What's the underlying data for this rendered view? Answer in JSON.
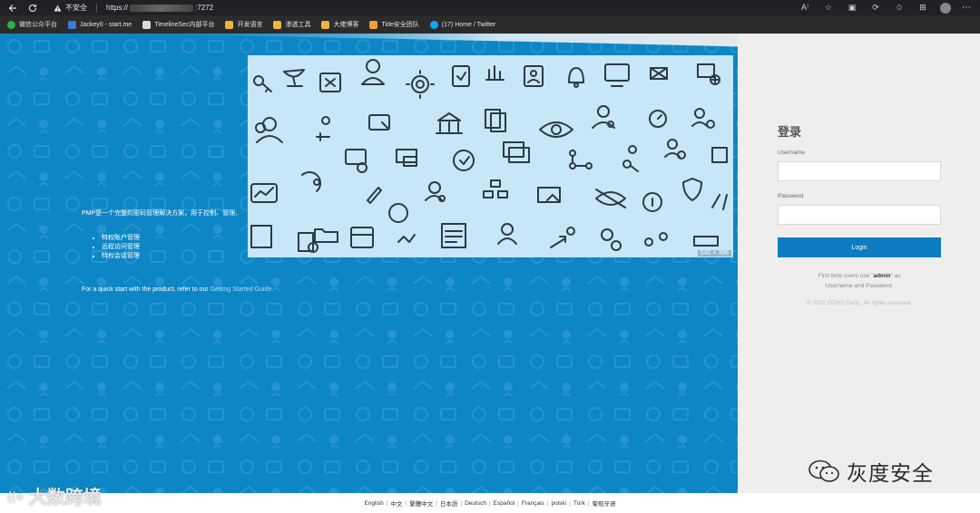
{
  "browser": {
    "not_secure_label": "不安全",
    "url_prefix": "https://",
    "url_suffix": ":7272",
    "bookmarks": [
      {
        "label": "微信公众平台",
        "color": "#2bb24c"
      },
      {
        "label": "Jackey0 - start.me",
        "color": "#3a7bd5"
      },
      {
        "label": "TimelineSec内部平台",
        "color": "#dddddd"
      },
      {
        "label": "开发语言",
        "color": "#e8b63c"
      },
      {
        "label": "渗透工具",
        "color": "#e8b63c"
      },
      {
        "label": "大佬博客",
        "color": "#e8b63c"
      },
      {
        "label": "Tide安全团队",
        "color": "#f0a030"
      },
      {
        "label": "(17) Home / Twitter",
        "color": "#1da1f2"
      }
    ]
  },
  "main": {
    "intro_text": "PMP是一个完整的密码管理解决方案，用于控制、管理、",
    "features": [
      "特权账户管理",
      "远程访问管理",
      "特权会话管理"
    ],
    "quick_text": "For a quick start with the product, refer to our ",
    "quick_link": "Getting Started Guide",
    "banner_size": "540 × 396"
  },
  "login": {
    "title": "登录",
    "username_label": "Username",
    "password_label": "Password",
    "login_button": "Login",
    "hint_pre": "First time users use \"",
    "hint_user": "admin",
    "hint_post": "\" as",
    "hint_line2": "Username and Password.",
    "copyright": "© 2022 ZOHO Corp., All rights reserved."
  },
  "footer": {
    "languages": [
      "English",
      "中文",
      "繁體中文",
      "日本語",
      "Deutsch",
      "Español",
      "Français",
      "polski",
      "Türk",
      "葡萄牙语"
    ]
  },
  "watermarks": {
    "left": "大数跨境",
    "right": "灰度安全"
  },
  "colors": {
    "main_blue": "#0d86c6",
    "button_blue": "#0d7cc2",
    "link": "#9ee4ff"
  }
}
